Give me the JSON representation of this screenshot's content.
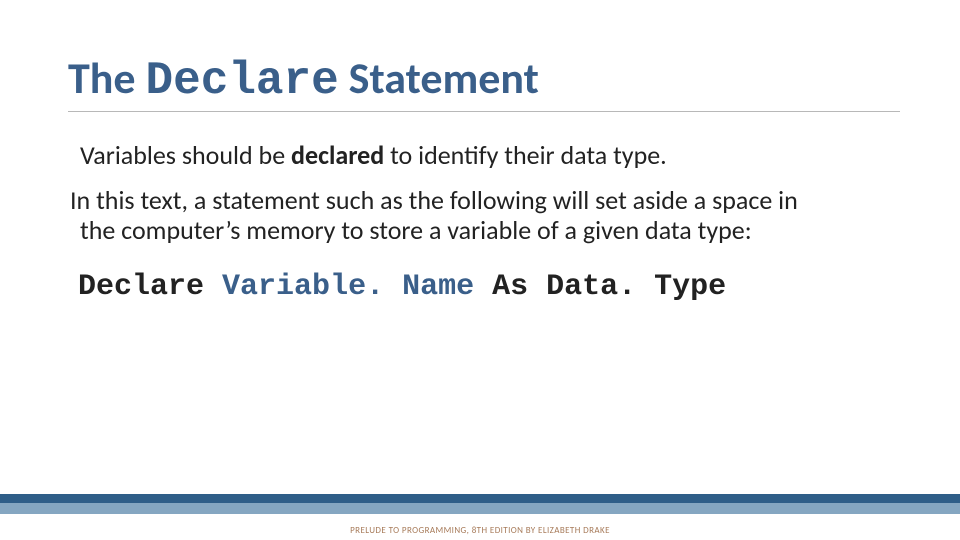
{
  "title": {
    "prefix": "The ",
    "mono": "Declare",
    "suffix": " Statement"
  },
  "body": {
    "p1_pre": "Variables should be ",
    "p1_bold": "declared",
    "p1_post": " to identify their data type.",
    "p2": "In this text, a statement such as the following will set aside a space in the computer’s memory to store a variable of a given data type:"
  },
  "code": {
    "kw1": "Declare",
    "var": "Variable. Name",
    "kw2": "As",
    "type": "Data. Type"
  },
  "footer": "PRELUDE TO PROGRAMMING, 8TH EDITION BY ELIZABETH DRAKE"
}
